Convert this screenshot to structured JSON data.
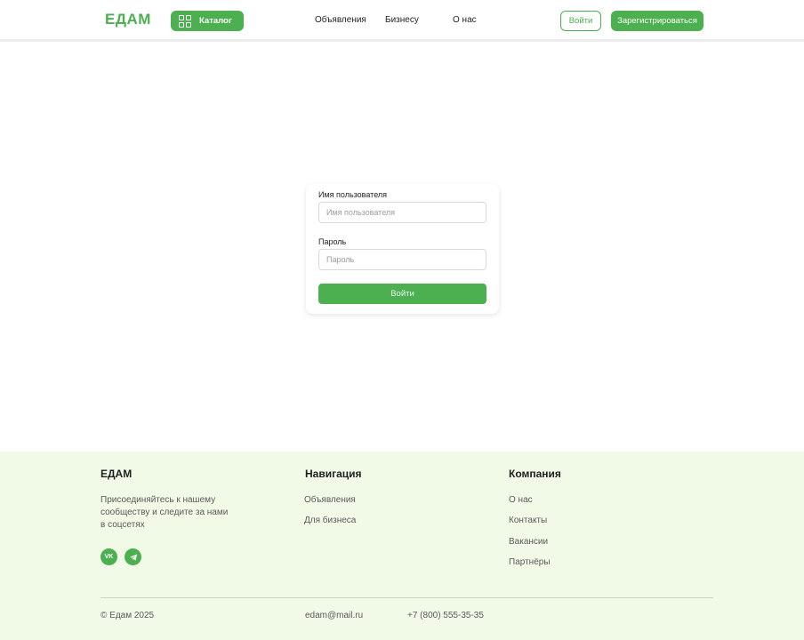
{
  "header": {
    "logo": "ЕДАМ",
    "catalog_label": "Каталог",
    "nav": [
      "Объявления",
      "Бизнесу",
      "О нас"
    ],
    "login_label": "Войти",
    "register_label": "Зарегистрироваться"
  },
  "login_form": {
    "username_label": "Имя пользователя",
    "username_placeholder": "Имя пользователя",
    "password_label": "Пароль",
    "password_placeholder": "Пароль",
    "submit_label": "Войти"
  },
  "footer": {
    "brand_title": "ЕДАМ",
    "brand_text_lines": [
      "Присоединяйтесь к нашему",
      "сообществу и следите за нами",
      "в соцсетях"
    ],
    "socials": [
      "vk-icon",
      "telegram-icon"
    ],
    "nav_title": "Навигация",
    "nav_links": [
      "Объявления",
      "Для бизнеса"
    ],
    "company_title": "Компания",
    "company_links": [
      "О нас",
      "Контакты",
      "Вакансии",
      "Партнёры"
    ],
    "copyright": "©  Едам 2025",
    "email": "edam@mail.ru",
    "phone": "+7 (800) 555-35-35"
  },
  "colors": {
    "accent": "#4caf50",
    "footer_bg": "#f1fae6"
  }
}
